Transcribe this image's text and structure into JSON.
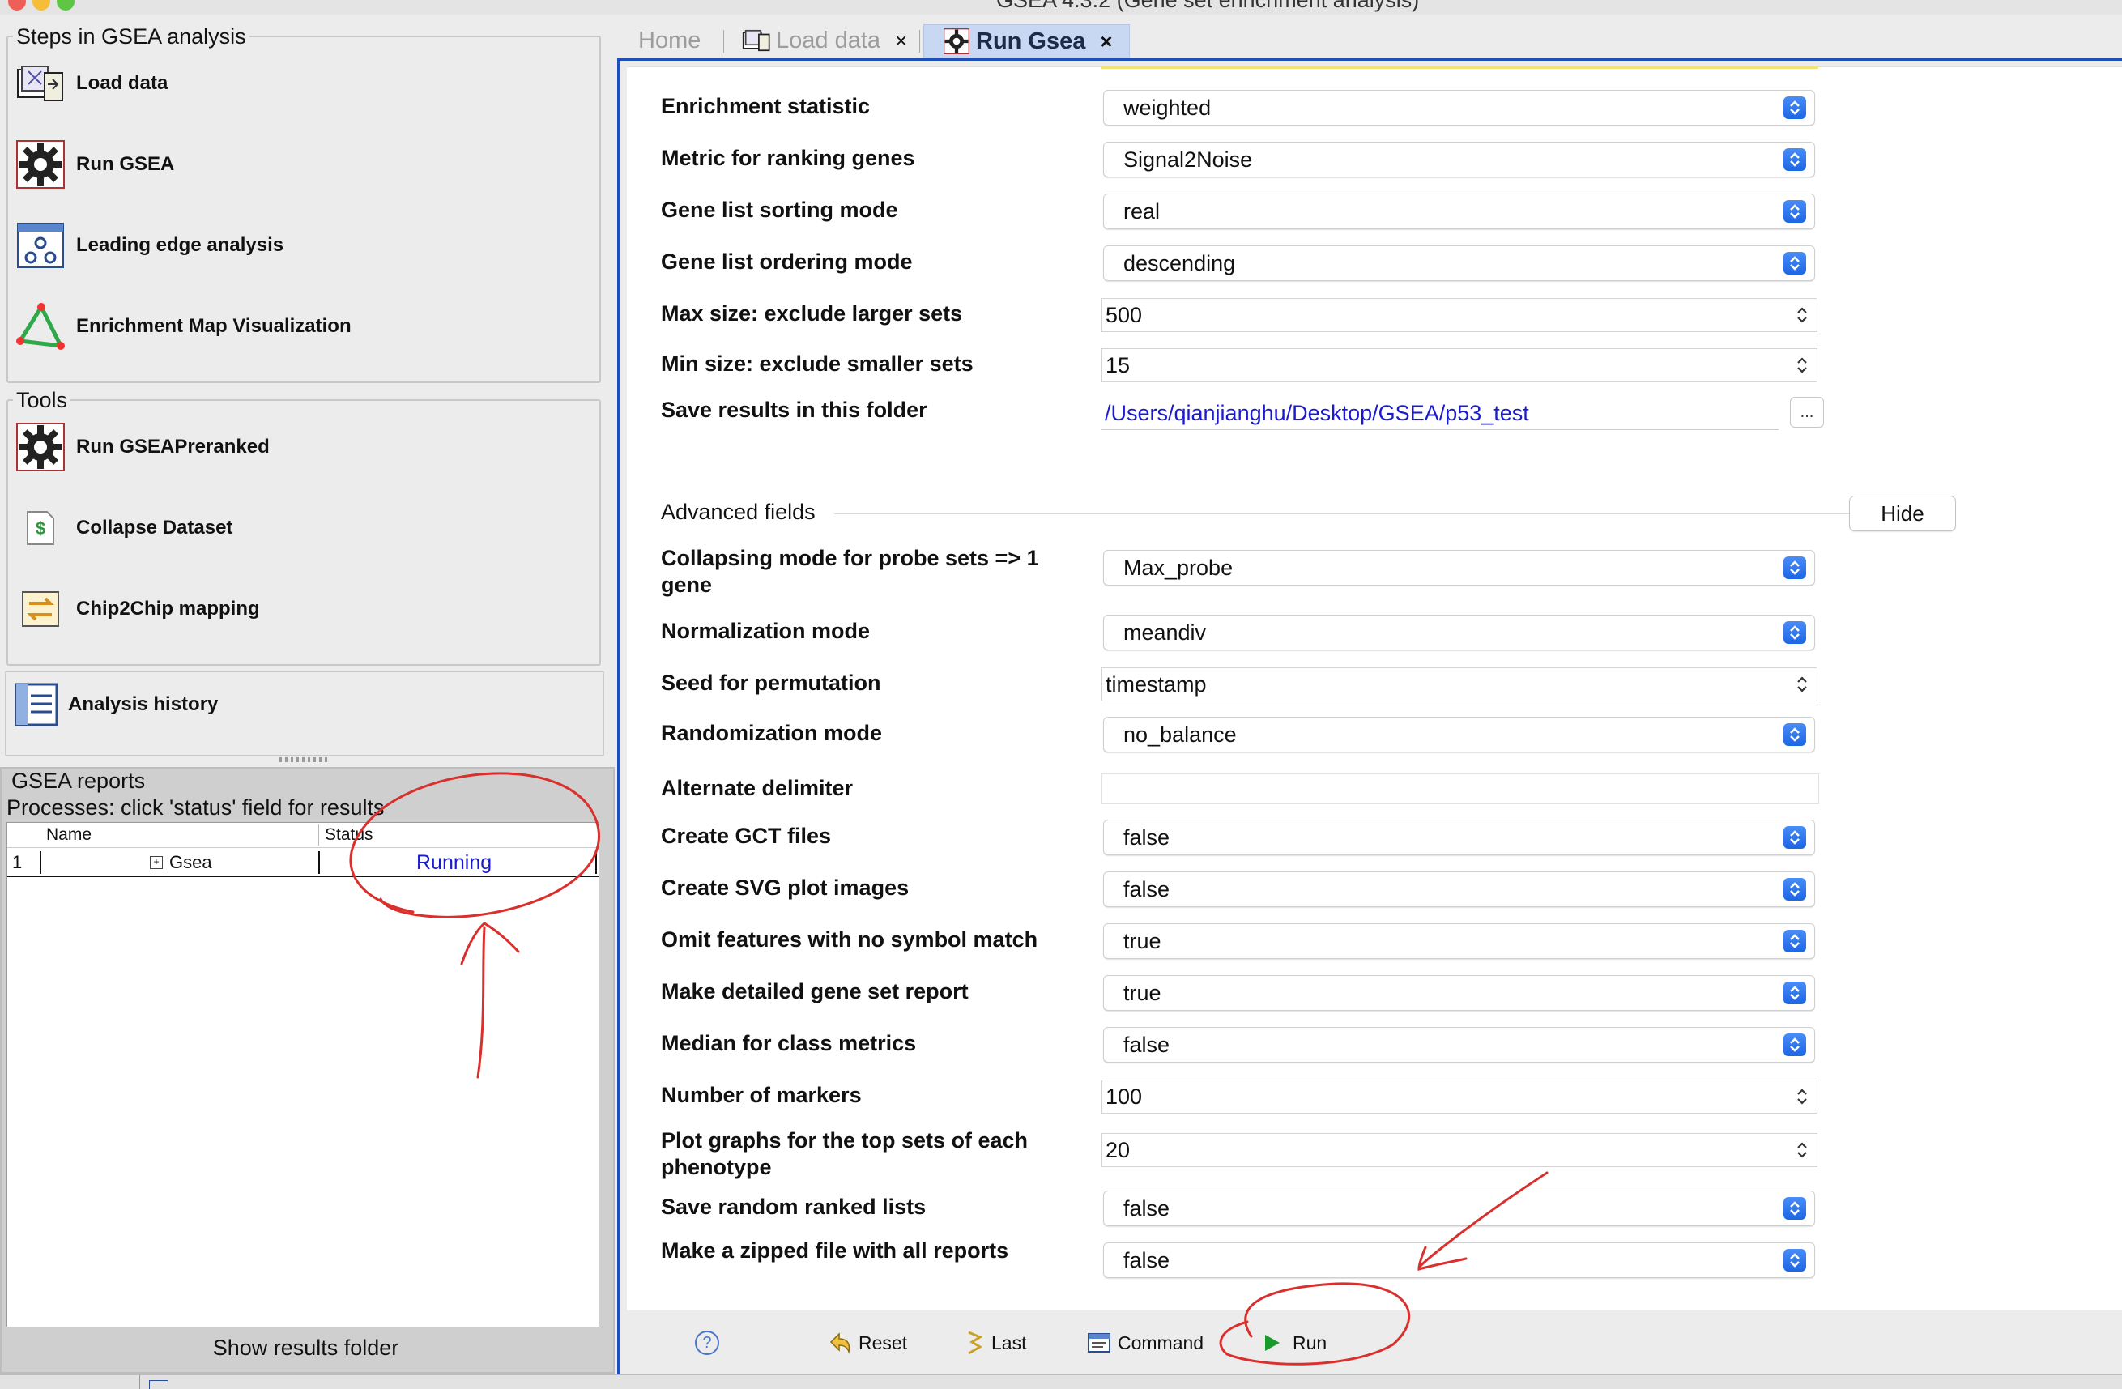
{
  "window": {
    "title": "GSEA 4.3.2 (Gene set enrichment analysis)"
  },
  "sidebar": {
    "steps_title": "Steps in GSEA analysis",
    "steps": [
      {
        "label": "Load data",
        "icon": "load-data-icon"
      },
      {
        "label": "Run GSEA",
        "icon": "gear-icon"
      },
      {
        "label": "Leading edge analysis",
        "icon": "leading-edge-icon"
      },
      {
        "label": "Enrichment Map Visualization",
        "icon": "triangle-network-icon"
      }
    ],
    "tools_title": "Tools",
    "tools": [
      {
        "label": "Run GSEAPreranked",
        "icon": "gear-icon"
      },
      {
        "label": "Collapse Dataset",
        "icon": "dollar-document-icon"
      },
      {
        "label": "Chip2Chip mapping",
        "icon": "swap-icon"
      }
    ],
    "history": {
      "label": "Analysis history",
      "icon": "history-list-icon"
    }
  },
  "reports": {
    "title": "GSEA reports",
    "subtitle": "Processes: click 'status' field for results",
    "columns": {
      "name": "Name",
      "status": "Status"
    },
    "rows": [
      {
        "index": "1",
        "name": "Gsea",
        "status": "Running"
      }
    ],
    "show_folder": "Show results folder"
  },
  "tabs": [
    {
      "label": "Home",
      "active": false
    },
    {
      "label": "Load data",
      "active": false,
      "close": "×"
    },
    {
      "label": "Run Gsea",
      "active": true,
      "close": "×"
    }
  ],
  "form": {
    "basic": [
      {
        "label": "Enrichment statistic",
        "value": "weighted",
        "kind": "combo"
      },
      {
        "label": "Metric for ranking genes",
        "value": "Signal2Noise",
        "kind": "combo"
      },
      {
        "label": "Gene list sorting mode",
        "value": "real",
        "kind": "combo"
      },
      {
        "label": "Gene list ordering mode",
        "value": "descending",
        "kind": "combo"
      },
      {
        "label": "Max size: exclude larger sets",
        "value": "500",
        "kind": "spinner"
      },
      {
        "label": "Min size: exclude smaller sets",
        "value": "15",
        "kind": "spinner"
      }
    ],
    "save_folder": {
      "label": "Save results in this folder",
      "value": "/Users/qianjianghu/Desktop/GSEA/p53_test",
      "browse": "..."
    },
    "advanced_title": "Advanced fields",
    "hide_label": "Hide",
    "advanced": [
      {
        "label": "Collapsing mode for probe sets => 1 gene",
        "value": "Max_probe",
        "kind": "combo"
      },
      {
        "label": "Normalization mode",
        "value": "meandiv",
        "kind": "combo"
      },
      {
        "label": "Seed for permutation",
        "value": "timestamp",
        "kind": "spinner"
      },
      {
        "label": "Randomization mode",
        "value": "no_balance",
        "kind": "combo"
      },
      {
        "label": "Alternate delimiter",
        "value": "",
        "kind": "text"
      },
      {
        "label": "Create GCT files",
        "value": "false",
        "kind": "combo"
      },
      {
        "label": "Create SVG plot images",
        "value": "false",
        "kind": "combo"
      },
      {
        "label": "Omit features with no symbol match",
        "value": "true",
        "kind": "combo"
      },
      {
        "label": "Make detailed gene set report",
        "value": "true",
        "kind": "combo"
      },
      {
        "label": "Median for class metrics",
        "value": "false",
        "kind": "combo"
      },
      {
        "label": "Number of markers",
        "value": "100",
        "kind": "spinner"
      },
      {
        "label": "Plot graphs for the top sets of each phenotype",
        "value": "20",
        "kind": "spinner"
      },
      {
        "label": "Save random ranked lists",
        "value": "false",
        "kind": "combo"
      },
      {
        "label": "Make a zipped file with all reports",
        "value": "false",
        "kind": "combo"
      }
    ]
  },
  "footer": {
    "help": "?",
    "reset": "Reset",
    "last": "Last",
    "command": "Command",
    "run": "Run"
  },
  "colors": {
    "accent_blue": "#1f4fb8",
    "combo_arrow": "#1c66e4",
    "link_blue": "#1a1ad0",
    "annotation_red": "#d9302e",
    "run_green": "#1a9a2a"
  }
}
